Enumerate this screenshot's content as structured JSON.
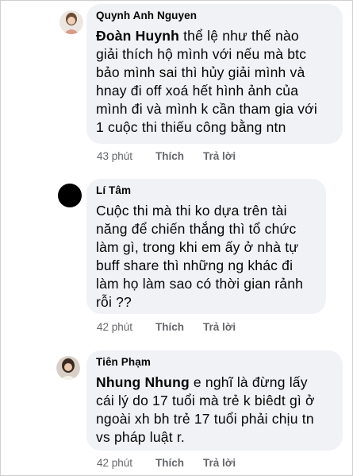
{
  "comments": [
    {
      "author": "Quynh Anh Nguyen",
      "mention": "Đoàn Huynh",
      "lines": [
        " thể lệ như thế nào",
        "giải thích hộ mình với nếu mà btc",
        "bảo mình sai thì hủy giải mình và",
        "hnay đi off xoá hết hình ảnh của",
        "mình đi và mình k cần tham gia với",
        "1 cuộc thi thiếu công bằng ntn"
      ],
      "time": "43 phút",
      "like": "Thích",
      "reply": "Trả lời"
    },
    {
      "author": "Lí Tâm",
      "mention": "",
      "lines": [
        "Cuộc thi mà thi ko dựa trên tài",
        "năng để chiến thắng thì tổ chức",
        "làm gì, trong khi em ấy ở nhà tự",
        "buff share thì những ng khác đi",
        "làm họ làm sao có thời gian rảnh",
        "rỗi ??"
      ],
      "time": "42 phút",
      "like": "Thích",
      "reply": "Trả lời"
    },
    {
      "author": "Tiên Phạm",
      "mention": "Nhung Nhung",
      "lines": [
        " e nghĩ là đừng lấy",
        "cái lý do 17 tuổi mà trẻ k biêdt gì ở",
        "ngoài xh bh trẻ 17 tuổi phải chịu tn",
        "vs pháp luật r."
      ],
      "time": "42 phút",
      "like": "Thích",
      "reply": "Trả lời"
    }
  ]
}
